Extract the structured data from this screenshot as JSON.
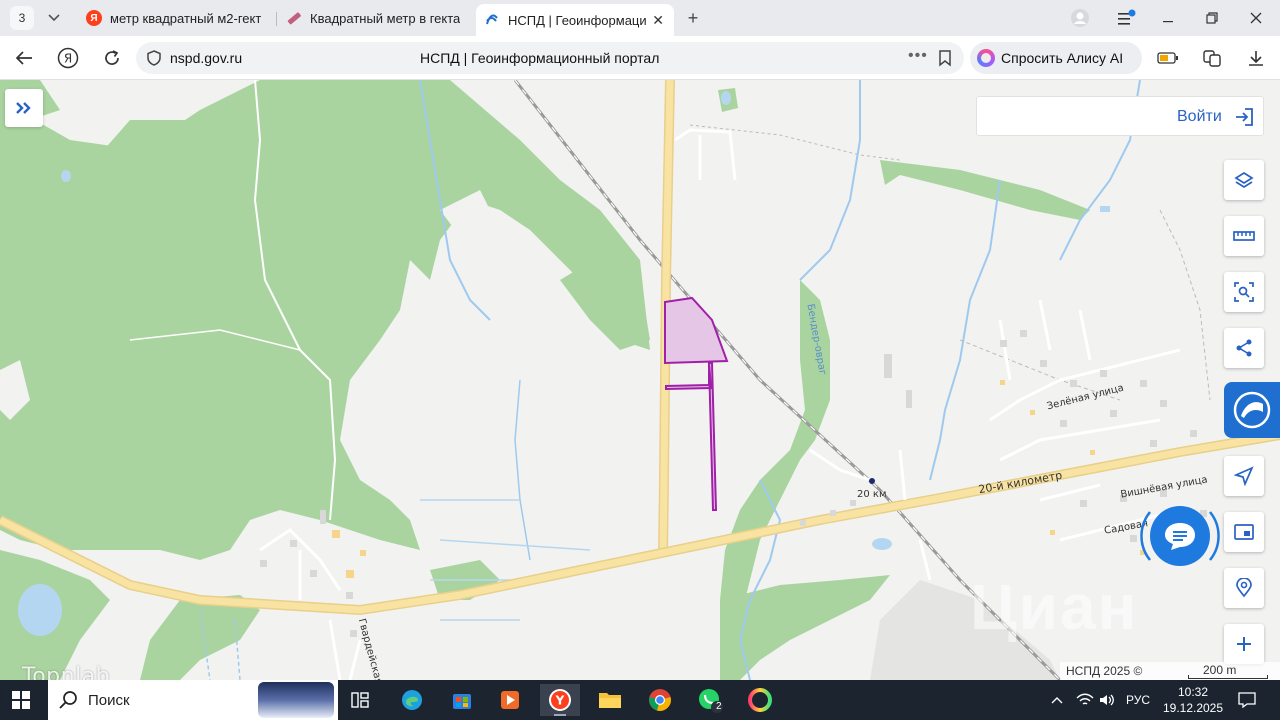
{
  "browser": {
    "tab_count": "3",
    "tabs": [
      {
        "title": "метр квадратный м2-гект",
        "icon": "yandex-icon",
        "color": "#fc3f1d"
      },
      {
        "title": "Квадратный метр в гекта",
        "icon": "ruler-icon",
        "color": "#b05070"
      },
      {
        "title": "НСПД | Геоинформаци",
        "icon": "nspd-icon",
        "color": "#1f6fd1",
        "active": true
      }
    ],
    "url_domain": "nspd.gov.ru",
    "page_title": "НСПД | Геоинформационный портал",
    "alice_label": "Спросить Алису AI"
  },
  "map": {
    "login_label": "Войти",
    "labels": {
      "road_20km": "20-й километр",
      "km_marker": "20 км",
      "zelenaya": "Зелёная улица",
      "vishnevaya": "Вишнёвая улица",
      "sadovaya": "Садовая",
      "gvardeyskaya": "Гвардейская",
      "ravine": "Бендер-овраг"
    },
    "copyright": "НСПД 2025 ©",
    "scale": "200 m",
    "watermark": "Циан",
    "colors": {
      "forest": "#a8d6a0",
      "road": "#f7df9c",
      "parcel": "#a020a8",
      "water": "#b5d6f0",
      "accent": "#2a62c4"
    },
    "tools": [
      "layers-icon",
      "ruler-icon",
      "select-area-icon",
      "share-icon",
      "nspd-logo-icon",
      "navigate-icon",
      "panel-icon",
      "geosearch-icon",
      "zoom-in-icon"
    ]
  },
  "taskbar": {
    "search_label": "Поиск",
    "whatsapp_badge": "2",
    "lang": "РУС",
    "time": "10:32",
    "date": "19.12.2025",
    "watermark": "Topnlab"
  }
}
